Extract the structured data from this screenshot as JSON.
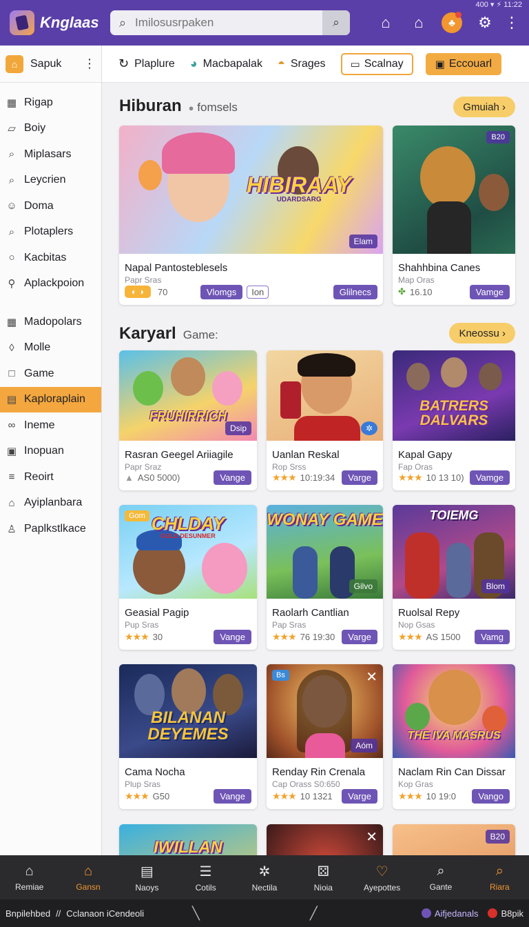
{
  "status": {
    "text": "400 ▾ ⚡ 11:22"
  },
  "app": {
    "name": "Knglaas"
  },
  "search": {
    "placeholder": "Imilosusrpaken"
  },
  "sidebar": {
    "header": "Sapuk",
    "group1": [
      {
        "label": "Rigap",
        "icon": "grid-icon"
      },
      {
        "label": "Boiy",
        "icon": "book-icon"
      },
      {
        "label": "Miplasars",
        "icon": "search-icon"
      },
      {
        "label": "Leycrien",
        "icon": "search-icon"
      },
      {
        "label": "Doma",
        "icon": "face-icon"
      },
      {
        "label": "Plotaplers",
        "icon": "search-icon"
      },
      {
        "label": "Kacbitas",
        "icon": "chat-icon"
      },
      {
        "label": "Aplackpoion",
        "icon": "key-icon"
      }
    ],
    "group2": [
      {
        "label": "Madopolars",
        "icon": "grid-icon"
      },
      {
        "label": "Molle",
        "icon": "pin-icon"
      },
      {
        "label": "Game",
        "icon": "square-icon"
      },
      {
        "label": "Kaploraplain",
        "icon": "grid-icon",
        "active": true
      },
      {
        "label": "Ineme",
        "icon": "link-icon"
      },
      {
        "label": "Inopuan",
        "icon": "image-icon"
      },
      {
        "label": "Reoirt",
        "icon": "stack-icon"
      },
      {
        "label": "Ayiplanbara",
        "icon": "home-icon"
      },
      {
        "label": "Paplkstlkace",
        "icon": "user-icon"
      }
    ]
  },
  "categories": [
    {
      "label": "Plaplure",
      "icon": "refresh-icon"
    },
    {
      "label": "Macbapalak",
      "icon": "chat-bubble-icon"
    },
    {
      "label": "Srages",
      "icon": "bowl-icon"
    },
    {
      "label": "Scalnay",
      "icon": "frame-icon",
      "style": "outline"
    },
    {
      "label": "Eccouarl",
      "icon": "image-icon",
      "style": "filled"
    }
  ],
  "section1": {
    "title": "Hiburan",
    "subtitle": "fomsels",
    "more": "Gmuiah",
    "cards": [
      {
        "title": "Napal Pantosteblesels",
        "sub": "Papr Sras",
        "tag": "Elam",
        "thumb_text": "HIBIRAAY",
        "thumb_sub": "UDARDSARG",
        "pill": "◐ ◑",
        "value": "70",
        "btn1": "Vlomgs",
        "btn2": "Ion",
        "btn3": "Glilnecs"
      },
      {
        "title": "Shahhbina Canes",
        "sub": "Map Oras",
        "tag_tl": "B20",
        "value": "16.10",
        "btn": "Vamge"
      }
    ]
  },
  "section2": {
    "title": "Karyarl",
    "subtitle": "Game:",
    "more": "Kneossu",
    "cards": [
      {
        "title": "Rasran Geegel Ariiagile",
        "sub": "Papr Sraz",
        "value": "AS0 5000)",
        "btn": "Vange",
        "thumb_text": "FRUHIRRICH",
        "tag": "Dsip",
        "stars": "none"
      },
      {
        "title": "Uanlan Reskal",
        "sub": "Rop Srss",
        "value": "10:19:34",
        "btn": "Varge",
        "stars": "★★★"
      },
      {
        "title": "Kapal Gapy",
        "sub": "Fap Oras",
        "value": "10 13 10)",
        "btn": "Vamge",
        "thumb_text": "BATRERS DALVARS",
        "stars": "★★★"
      },
      {
        "title": "Geasial Pagip",
        "sub": "Pup Sras",
        "value": "30",
        "btn": "Vange",
        "thumb_text": "CHLDAY",
        "thumb_sub": "GULD DESUNMER",
        "tag_tl": "Gom",
        "stars": "★★★"
      },
      {
        "title": "Raolarh Cantlian",
        "sub": "Pap Sras",
        "value": "76 19:30",
        "btn": "Varge",
        "thumb_text": "WONAY GAME",
        "tag": "Gilvo",
        "stars": "★★★"
      },
      {
        "title": "Ruolsal Repy",
        "sub": "Nop Gsas",
        "value": "AS 1500",
        "btn": "Vamg",
        "thumb_text": "TOIEMG",
        "tag": "Blom",
        "stars": "★★★"
      },
      {
        "title": "Cama Nocha",
        "sub": "Plup Sras",
        "value": "G50",
        "btn": "Vange",
        "thumb_text": "BILANAN DEYEMES",
        "stars": "★★★"
      },
      {
        "title": "Renday Rin Crenala",
        "sub": "Cap Orass S0:650",
        "value": "10 1321",
        "btn": "Varge",
        "tag": "Aóm",
        "tag_tl": "Bs",
        "stars": "★★★"
      },
      {
        "title": "Naclam Rin Can Dissar",
        "sub": "Kop Gras",
        "value": "10 19:0",
        "btn": "Vango",
        "thumb_text": "THE IVA MASRUS",
        "stars": "★★★"
      }
    ],
    "partial_cards": [
      {
        "thumb_text": "IWILLAN"
      },
      {
        "thumb_text": ""
      },
      {
        "tag_tl": "B20"
      }
    ]
  },
  "bottom_nav": [
    {
      "label": "Remiae",
      "icon": "home-icon"
    },
    {
      "label": "Gansn",
      "icon": "home-icon",
      "active": true
    },
    {
      "label": "Naoys",
      "icon": "document-icon"
    },
    {
      "label": "Cotils",
      "icon": "list-icon"
    },
    {
      "label": "Nectila",
      "icon": "gear-icon"
    },
    {
      "label": "Nioia",
      "icon": "dice-icon"
    },
    {
      "label": "Ayepottes",
      "icon": "heart-icon"
    },
    {
      "label": "Gante",
      "icon": "search-icon"
    },
    {
      "label": "Riara",
      "icon": "search-icon"
    }
  ],
  "system_bar": {
    "left": "Bnpilehbed",
    "left2": "//",
    "left3": "Cclanaon iCendeoli",
    "chip1": "Aifjedanals",
    "chip2": "B8pik"
  },
  "colors": {
    "brand_purple": "#5b3fa8",
    "accent_orange": "#f3a73e",
    "button_purple": "#6e55b5"
  }
}
